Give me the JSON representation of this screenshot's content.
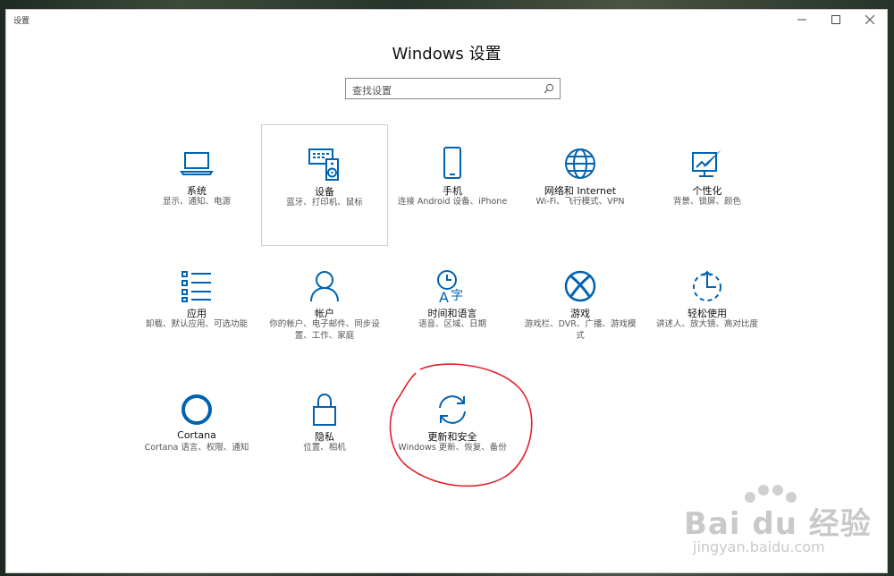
{
  "window": {
    "title": "设置",
    "controls": [
      "minimize",
      "maximize",
      "close"
    ]
  },
  "header": {
    "title": "Windows 设置"
  },
  "search": {
    "placeholder": "查找设置"
  },
  "colors": {
    "accent": "#0063b1",
    "annotation": "#e0212b"
  },
  "tiles": [
    {
      "name": "系统",
      "desc": "显示、通知、电源",
      "icon": "laptop-icon"
    },
    {
      "name": "设备",
      "desc": "蓝牙、打印机、鼠标",
      "icon": "devices-icon"
    },
    {
      "name": "手机",
      "desc": "连接 Android 设备、iPhone",
      "icon": "phone-icon"
    },
    {
      "name": "网络和 Internet",
      "desc": "Wi-Fi、飞行模式、VPN",
      "icon": "globe-icon"
    },
    {
      "name": "个性化",
      "desc": "背景、锁屏、颜色",
      "icon": "personalize-icon"
    },
    {
      "name": "应用",
      "desc": "卸载、默认应用、可选功能",
      "icon": "apps-list-icon"
    },
    {
      "name": "帐户",
      "desc": "你的帐户、电子邮件、同步设置、工作、家庭",
      "icon": "person-icon"
    },
    {
      "name": "时间和语言",
      "desc": "语音、区域、日期",
      "icon": "time-language-icon"
    },
    {
      "name": "游戏",
      "desc": "游戏栏、DVR、广播、游戏模式",
      "icon": "xbox-icon"
    },
    {
      "name": "轻松使用",
      "desc": "讲述人、放大镜、高对比度",
      "icon": "ease-of-access-icon"
    },
    {
      "name": "Cortana",
      "desc": "Cortana 语言、权限、通知",
      "icon": "cortana-icon"
    },
    {
      "name": "隐私",
      "desc": "位置、相机",
      "icon": "lock-icon"
    },
    {
      "name": "更新和安全",
      "desc": "Windows 更新、恢复、备份",
      "icon": "sync-icon"
    }
  ],
  "watermark": {
    "brand": "Bai du 经验",
    "url": "jingyan.baidu.com"
  }
}
